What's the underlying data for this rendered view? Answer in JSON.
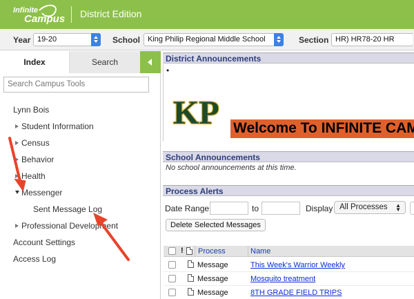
{
  "header": {
    "logo_line1": "Infinite",
    "logo_line2": "Campus",
    "edition": "District Edition",
    "brand_color": "#8cc04b"
  },
  "selectors": {
    "year_label": "Year",
    "year_value": "19-20",
    "school_label": "School",
    "school_value": "King Philip Regional Middle School",
    "section_label": "Section",
    "section_value": "HR) HR78-20 HR"
  },
  "sidebar": {
    "tab_index": "Index",
    "tab_search": "Search",
    "search_placeholder": "Search Campus Tools",
    "items": [
      {
        "label": "Lynn Bois"
      },
      {
        "label": "Student Information"
      },
      {
        "label": "Census"
      },
      {
        "label": "Behavior"
      },
      {
        "label": "Health"
      },
      {
        "label": "Messenger"
      },
      {
        "label": "Sent Message Log"
      },
      {
        "label": "Professional Development"
      },
      {
        "label": "Account Settings"
      },
      {
        "label": "Access Log"
      }
    ]
  },
  "district": {
    "title": "District Announcements",
    "bullet": "•",
    "logo_text": "KP",
    "welcome": "Welcome To INFINITE CAMPUS"
  },
  "school": {
    "title": "School Announcements",
    "empty": "No school announcements at this time."
  },
  "alerts": {
    "title": "Process Alerts",
    "date_range_label": "Date Range",
    "to_label": "to",
    "display_label": "Display",
    "display_value": "All Processes",
    "delete_button": "Delete Selected Messages",
    "col_flag": "!",
    "col_process": "Process",
    "col_name": "Name",
    "rows": [
      {
        "process": "Message",
        "name": "This Week's Warrior Weekly"
      },
      {
        "process": "Message",
        "name": "Mosquito treatment"
      },
      {
        "process": "Message",
        "name": "8TH GRADE FIELD TRIPS"
      }
    ]
  }
}
